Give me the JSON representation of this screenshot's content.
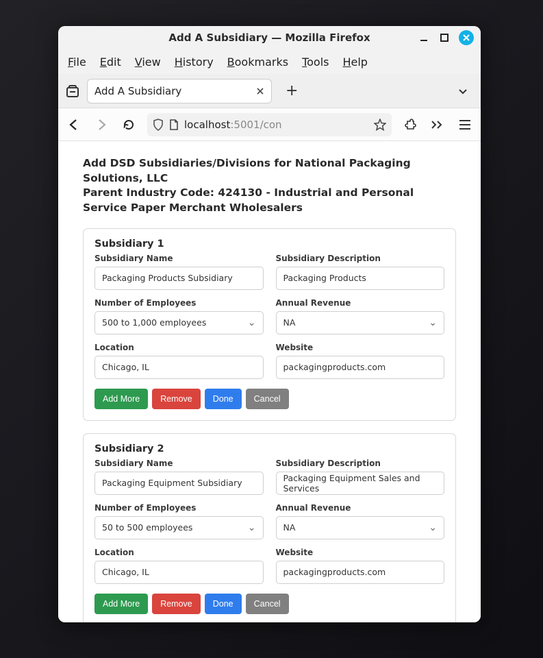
{
  "window_title": "Add A Subsidiary — Mozilla Firefox",
  "menubar": [
    "File",
    "Edit",
    "View",
    "History",
    "Bookmarks",
    "Tools",
    "Help"
  ],
  "tab": {
    "title": "Add A Subsidiary"
  },
  "url": {
    "host": "localhost",
    "rest": ":5001/con"
  },
  "heading_line1": "Add DSD Subsidiaries/Divisions for National Packaging Solutions, LLC",
  "heading_line2": "Parent Industry Code: 424130 - Industrial and Personal Service Paper Merchant Wholesalers",
  "labels": {
    "name": "Subsidiary Name",
    "desc": "Subsidiary Description",
    "employees": "Number of Employees",
    "revenue": "Annual Revenue",
    "location": "Location",
    "website": "Website"
  },
  "buttons": {
    "add": "Add More",
    "remove": "Remove",
    "done": "Done",
    "cancel": "Cancel"
  },
  "subs": [
    {
      "title": "Subsidiary 1",
      "name": "Packaging Products Subsidiary",
      "desc": "Packaging Products",
      "employees": "500 to 1,000 employees",
      "revenue": "NA",
      "location": "Chicago, IL",
      "website": "packagingproducts.com"
    },
    {
      "title": "Subsidiary 2",
      "name": "Packaging Equipment Subsidiary",
      "desc": "Packaging Equipment Sales and Services",
      "employees": "50 to 500 employees",
      "revenue": "NA",
      "location": "Chicago, IL",
      "website": "packagingproducts.com"
    }
  ]
}
